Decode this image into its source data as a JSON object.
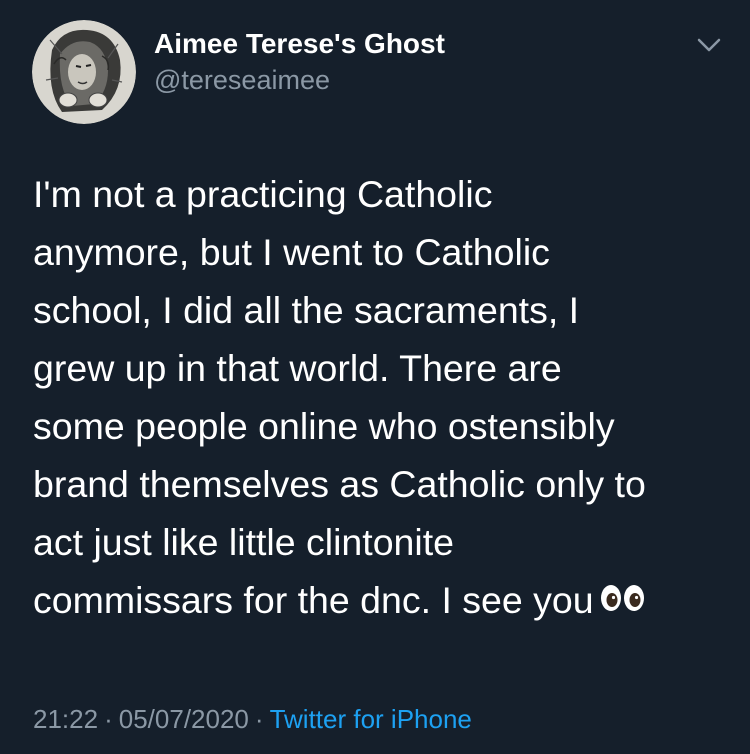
{
  "author": {
    "display_name": "Aimee Terese's Ghost",
    "handle": "@tereseaimee"
  },
  "tweet": {
    "lines": [
      "I'm not a practicing Catholic",
      "anymore, but I went to Catholic",
      "school, I did all the sacraments, I",
      "grew up in that world. There are",
      "some people online who ostensibly",
      "brand themselves as Catholic only to",
      "act just like little clintonite",
      "commissars for the dnc. I see you"
    ],
    "emoji": "eyes-emoji"
  },
  "meta": {
    "time": "21:22",
    "date": "05/07/2020",
    "separator": "·",
    "source": "Twitter for iPhone"
  },
  "colors": {
    "background": "#151f2b",
    "text": "#ffffff",
    "secondary": "#8b98a5",
    "link": "#1da1f2"
  },
  "icons": {
    "avatar": "avatar-image",
    "menu": "chevron-down-icon"
  }
}
